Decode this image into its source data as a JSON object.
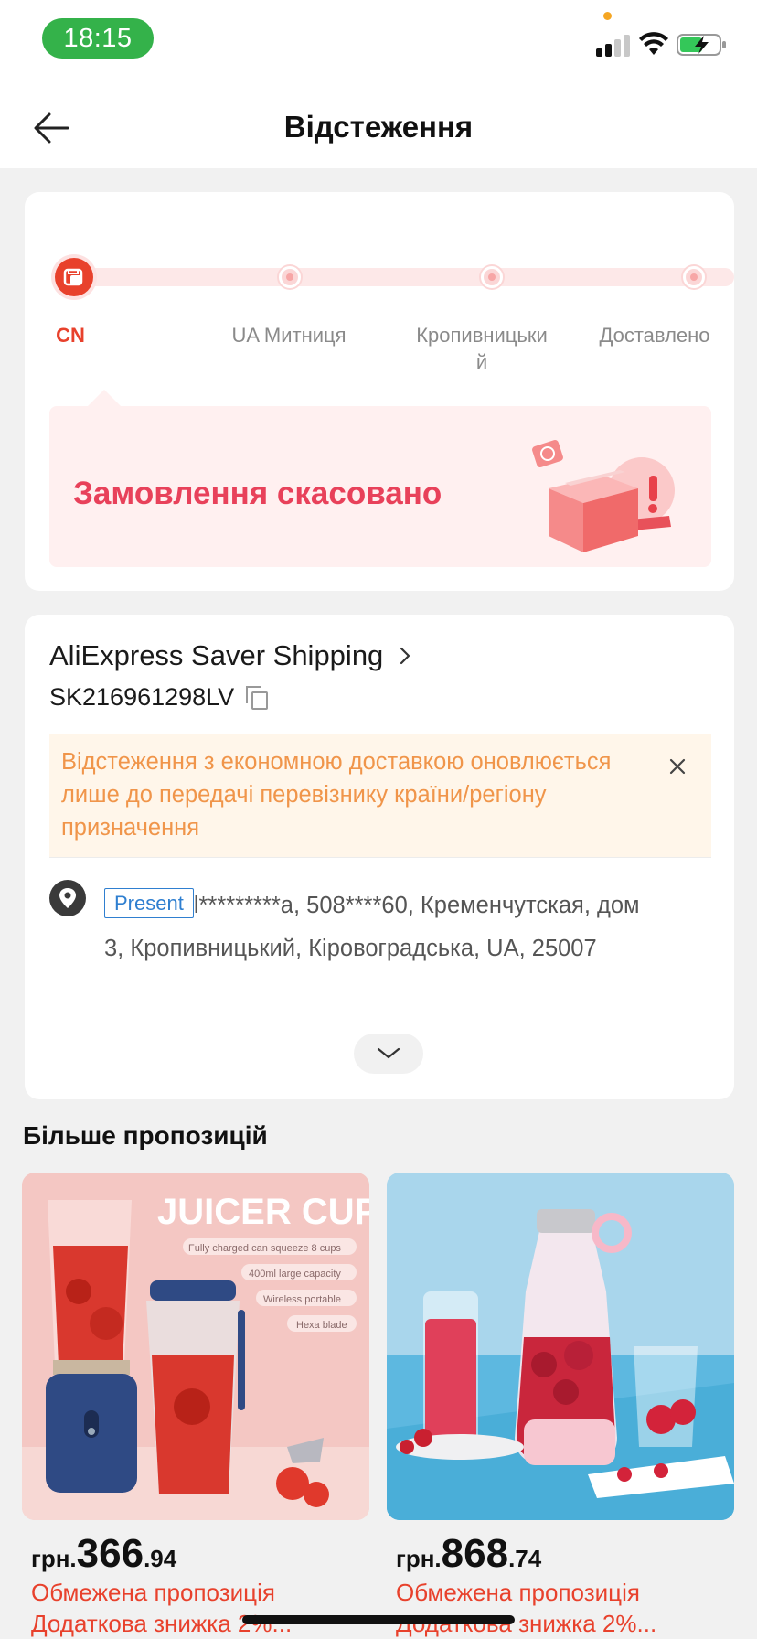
{
  "status_bar": {
    "time": "18:15"
  },
  "header": {
    "title": "Відстеження"
  },
  "progress": {
    "steps": [
      {
        "label": "CN",
        "active": true
      },
      {
        "label": "UA Митниця",
        "active": false
      },
      {
        "label": "Кропивницьки",
        "label_wrap": "й",
        "active": false
      },
      {
        "label": "Доставлено",
        "active": false
      }
    ],
    "status_message": "Замовлення скасовано"
  },
  "shipping": {
    "carrier": "AliExpress Saver Shipping",
    "tracking_number": "SK216961298LV",
    "notice": "Відстеження з економною доставкою оновлюється лише до передачі перевізнику країни/регіону призначення",
    "address_badge": "Present",
    "address_line1": "l*********а,  508****60,  Кременчутская,  дом",
    "address_line2": "3,  Кропивницький,  Кіровоградська,  UA,  25007"
  },
  "recommendations": {
    "title": "Більше пропозицій",
    "products": [
      {
        "image_text": "JUICER CUP",
        "image_features": [
          "Fully charged can squeeze 8 cups",
          "400ml large capacity",
          "Wireless portable",
          "Hexa blade"
        ],
        "currency": "грн.",
        "price_int": "366",
        "price_dec": ".94",
        "promo1": "Обмежена пропозиція",
        "promo2": "Додаткова знижка 2%..."
      },
      {
        "currency": "грн.",
        "price_int": "868",
        "price_dec": ".74",
        "promo1": "Обмежена пропозиція",
        "promo2": "Додаткова знижка 2%..."
      }
    ]
  },
  "colors": {
    "accent": "#e8412c",
    "status_text": "#e8415a",
    "notice_text": "#f0954a",
    "link_blue": "#2f7fd0",
    "time_pill": "#34b24a"
  }
}
